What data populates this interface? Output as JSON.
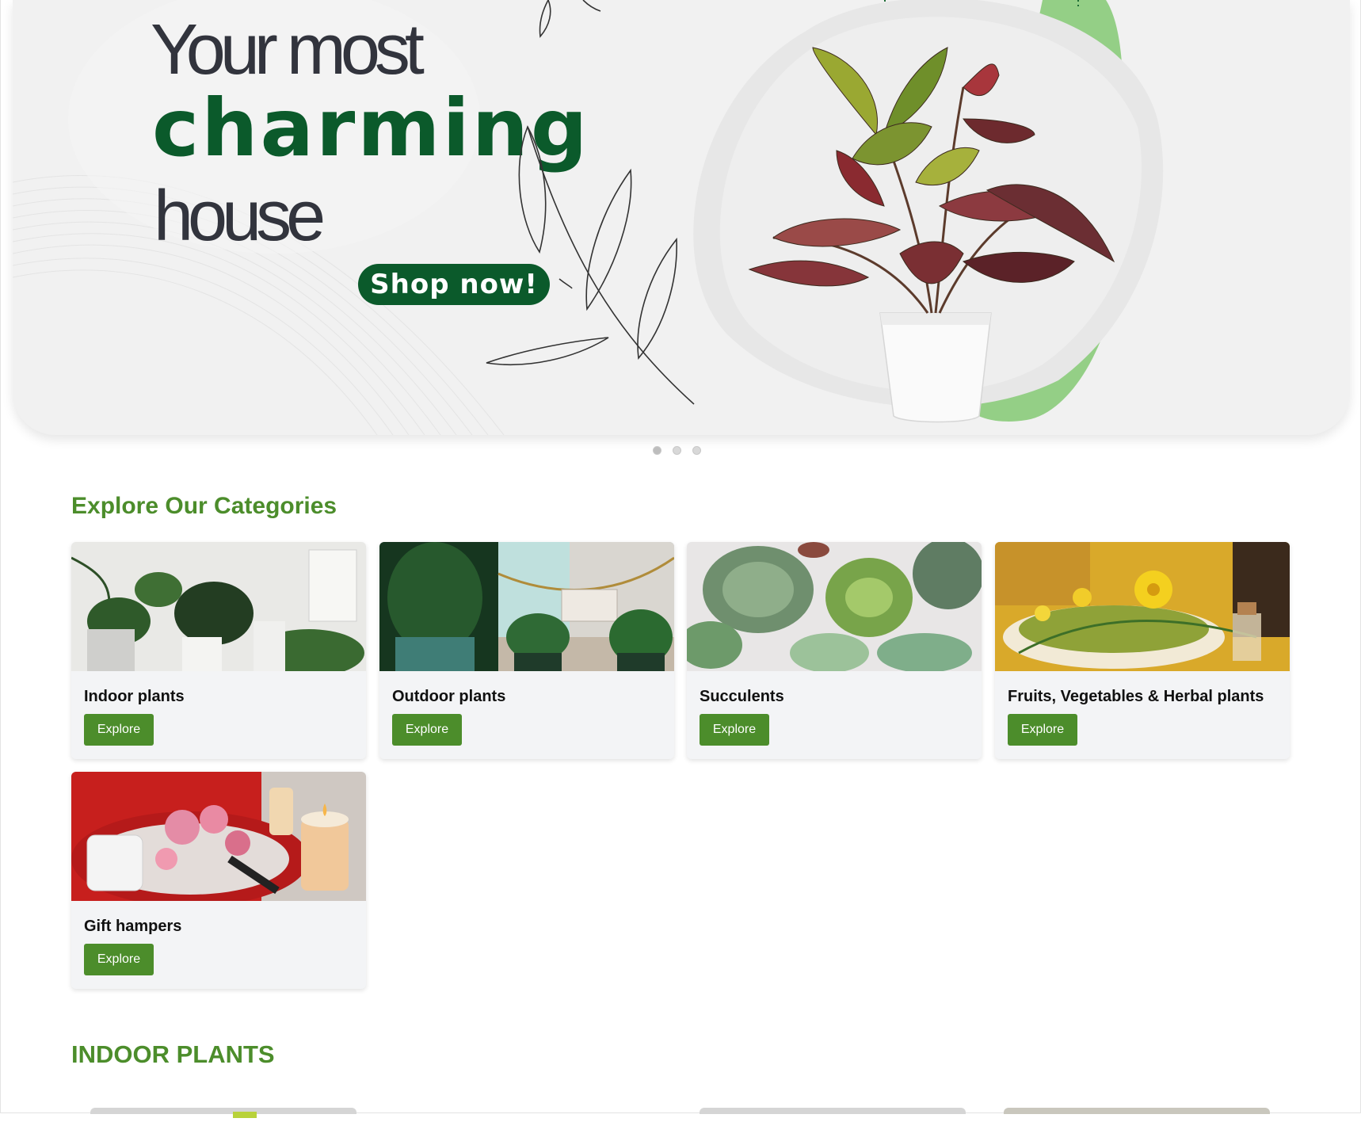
{
  "hero": {
    "line1": "Your most",
    "line2": "charming",
    "line3": "house",
    "cta_label": "Shop now!"
  },
  "carousel": {
    "slide_count": 3,
    "active_index": 0
  },
  "categories": {
    "title": "Explore Our Categories",
    "items": [
      {
        "label": "Indoor plants",
        "button": "Explore"
      },
      {
        "label": "Outdoor plants",
        "button": "Explore"
      },
      {
        "label": "Succulents",
        "button": "Explore"
      },
      {
        "label": "Fruits, Vegetables & Herbal plants",
        "button": "Explore"
      },
      {
        "label": "Gift hampers",
        "button": "Explore"
      }
    ]
  },
  "indoor_section": {
    "title": "INDOOR PLANTS"
  },
  "colors": {
    "brand_dark_green": "#0b5a2b",
    "accent_green": "#4c8d2b",
    "light_green": "#94cf86",
    "hero_background": "#f1f1f1",
    "card_background": "#f3f4f6"
  }
}
